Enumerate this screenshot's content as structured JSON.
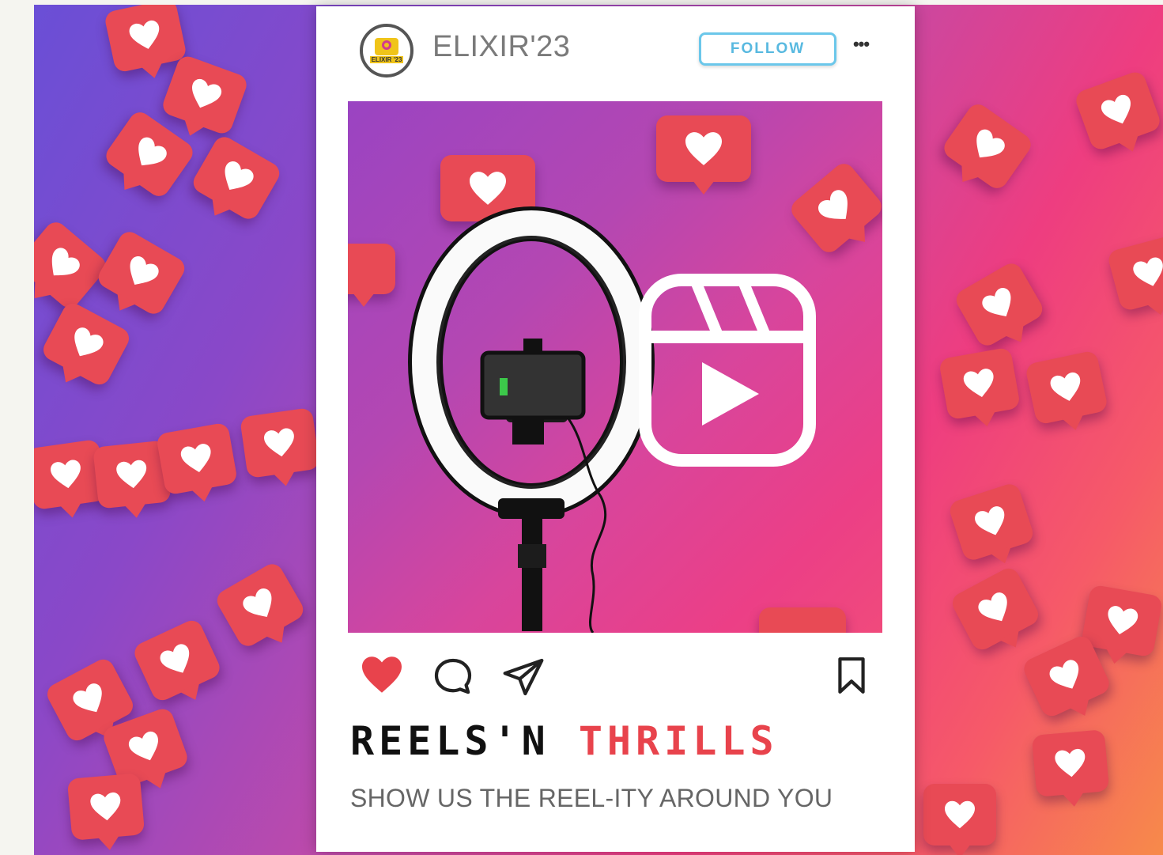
{
  "post": {
    "username": "ELIXIR'23",
    "avatar_label": "ELIXIR '23",
    "follow_label": "FOLLOW",
    "more_label": "•••",
    "title_part1": "REELS'N",
    "title_part2": "THRILLS",
    "subtitle": "SHOW US THE REEL-ITY AROUND YOU"
  },
  "actions": {
    "like_icon": "heart-filled-icon",
    "comment_icon": "comment-bubble-icon",
    "share_icon": "paper-plane-icon",
    "save_icon": "bookmark-icon"
  },
  "colors": {
    "like": "#e8434c",
    "follow_border": "#6bc7ea",
    "accent_title": "#e8434c",
    "heart_tile": "#e84a55"
  }
}
